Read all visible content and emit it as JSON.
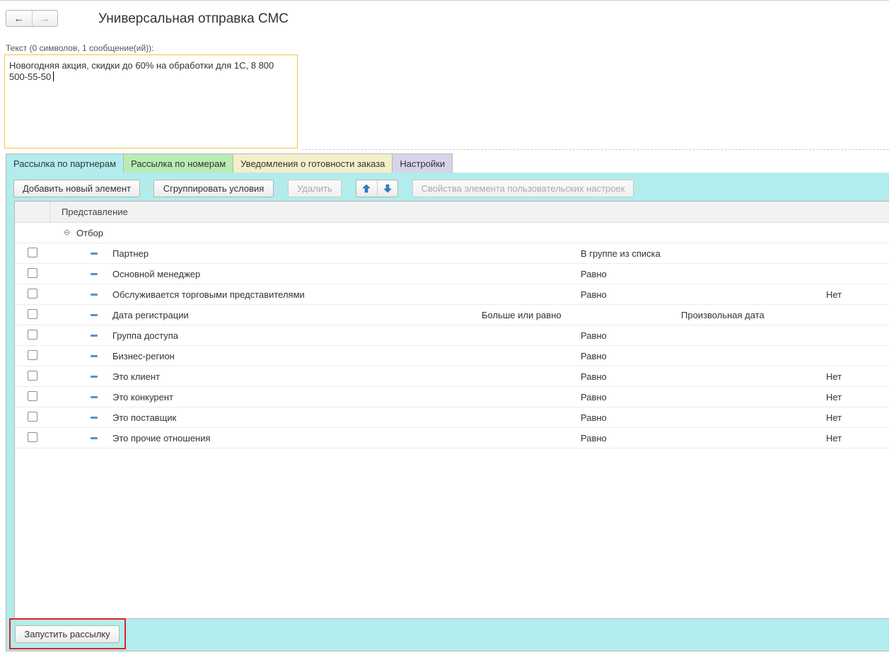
{
  "header": {
    "back_icon": "arrow-left-icon",
    "forward_icon": "arrow-right-icon",
    "title": "Универсальная отправка СМС"
  },
  "message": {
    "label": "Текст (0 символов, 1 сообщение(ий)):",
    "value": "Новогодняя акция, скидки до 60% на обработки для 1С, 8 800\n500-55-50"
  },
  "tabs": [
    {
      "label": "Рассылка по партнерам",
      "color": "#b3ecec"
    },
    {
      "label": "Рассылка по номерам",
      "color": "#b9ebb6"
    },
    {
      "label": "Уведомления о готовности заказа",
      "color": "#f3efc9"
    },
    {
      "label": "Настройки",
      "color": "#d7d4ea"
    }
  ],
  "toolbar": {
    "add_label": "Добавить новый элемент",
    "group_label": "Сгруппировать условия",
    "delete_label": "Удалить",
    "up_icon": "arrow-up-icon",
    "down_icon": "arrow-down-icon",
    "props_label": "Свойства элемента пользовательских настроек"
  },
  "table": {
    "column_header": "Представление",
    "group_label": "Отбор",
    "rows": [
      {
        "name": "Партнер",
        "condition": "В группе из списка",
        "value": "",
        "extra": ""
      },
      {
        "name": "Основной менеджер",
        "condition": "Равно",
        "value": "",
        "extra": ""
      },
      {
        "name": "Обслуживается торговыми представителями",
        "condition": "Равно",
        "value": "",
        "extra": "Нет"
      },
      {
        "name": "Дата регистрации",
        "condition": "Больше или равно",
        "value": "Произвольная дата",
        "extra": ""
      },
      {
        "name": "Группа доступа",
        "condition": "Равно",
        "value": "",
        "extra": ""
      },
      {
        "name": "Бизнес-регион",
        "condition": "Равно",
        "value": "",
        "extra": ""
      },
      {
        "name": "Это клиент",
        "condition": "Равно",
        "value": "",
        "extra": "Нет"
      },
      {
        "name": "Это конкурент",
        "condition": "Равно",
        "value": "",
        "extra": "Нет"
      },
      {
        "name": "Это поставщик",
        "condition": "Равно",
        "value": "",
        "extra": "Нет"
      },
      {
        "name": "Это прочие отношения",
        "condition": "Равно",
        "value": "",
        "extra": "Нет"
      }
    ]
  },
  "footer": {
    "launch_label": "Запустить рассылку",
    "highlight_color": "#e02020"
  }
}
